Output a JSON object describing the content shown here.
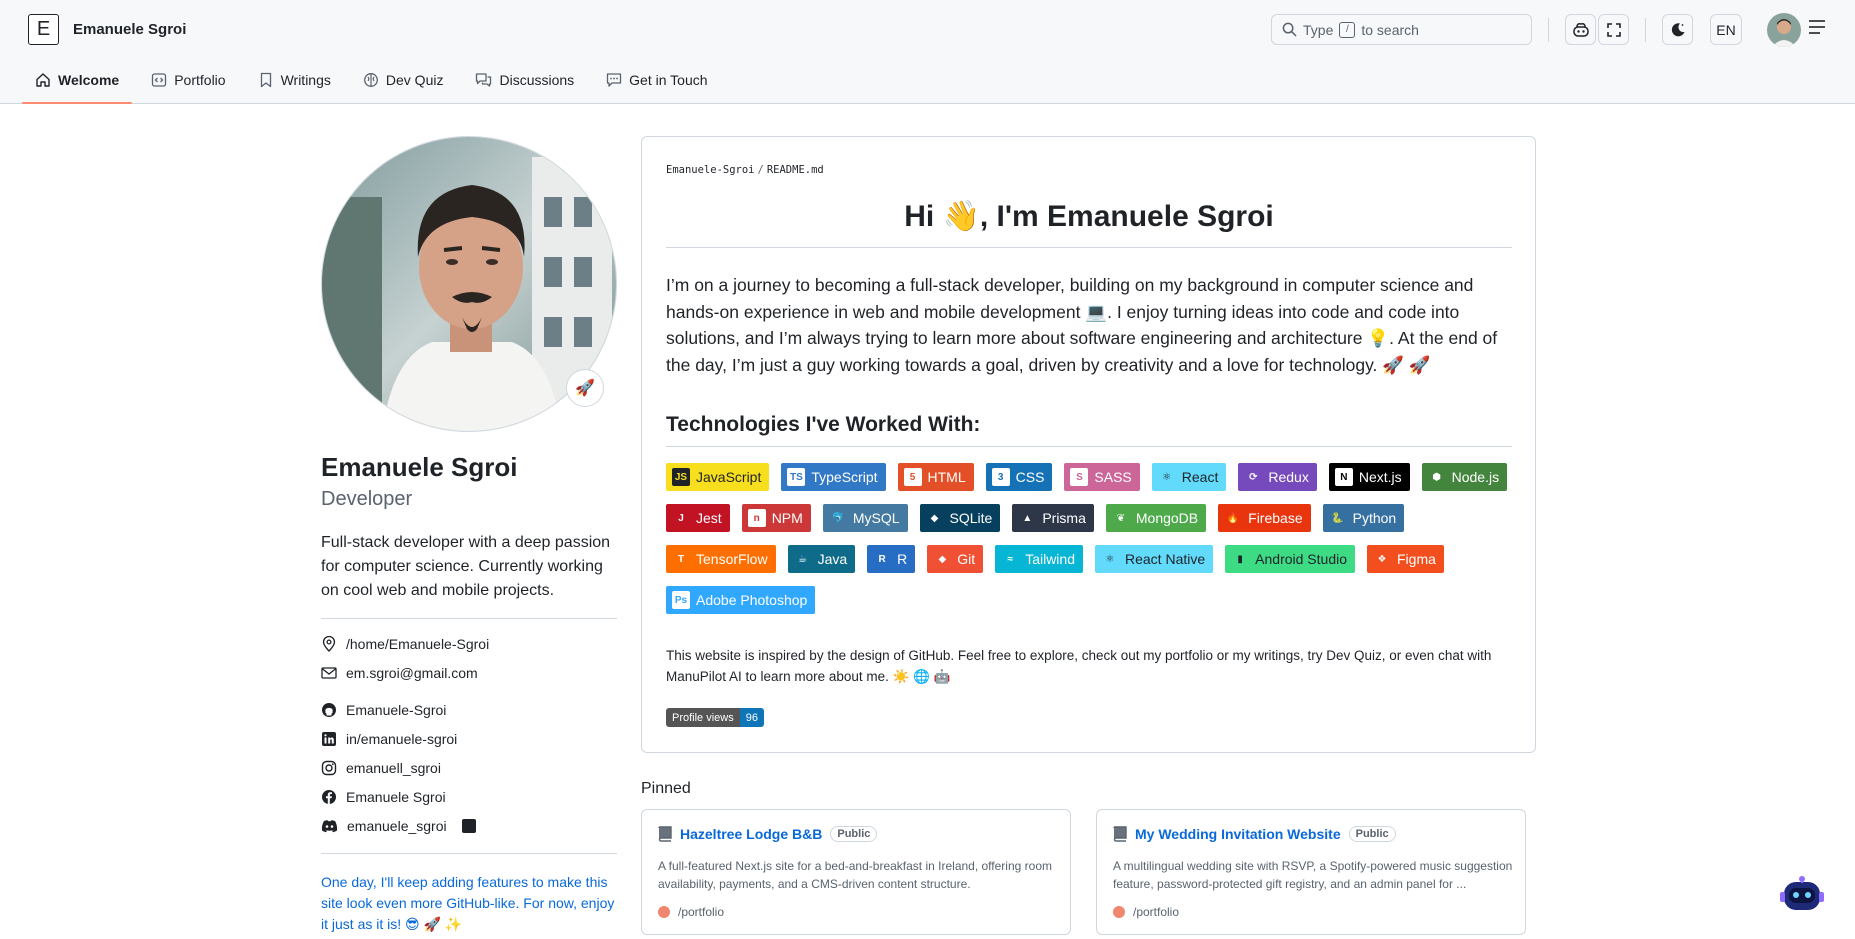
{
  "header": {
    "logo_letter": "E",
    "site_title": "Emanuele Sgroi",
    "search_prefix": "Type",
    "search_key": "/",
    "search_suffix": "to search",
    "lang": "EN"
  },
  "nav": [
    {
      "label": "Welcome",
      "icon": "home-icon",
      "active": true
    },
    {
      "label": "Portfolio",
      "icon": "code-square-icon"
    },
    {
      "label": "Writings",
      "icon": "bookmark-icon"
    },
    {
      "label": "Dev Quiz",
      "icon": "brain-icon"
    },
    {
      "label": "Discussions",
      "icon": "comments-icon"
    },
    {
      "label": "Get in Touch",
      "icon": "message-icon"
    }
  ],
  "profile": {
    "status_emoji": "🚀",
    "name": "Emanuele Sgroi",
    "role": "Developer",
    "bio": "Full-stack developer with a deep passion for computer science. Currently working on cool web and mobile projects.",
    "location": "/home/Emanuele-Sgroi",
    "email": "em.sgroi@gmail.com",
    "github": "Emanuele-Sgroi",
    "linkedin": "in/emanuele-sgroi",
    "instagram": "emanuell_sgroi",
    "facebook": "Emanuele Sgroi",
    "discord": "emanuele_sgroi",
    "note": "One day, I'll keep adding features to make this site look even more GitHub-like. For now, enjoy it just as it is! 😎 🚀 ✨"
  },
  "readme": {
    "path_user": "Emanuele-Sgroi",
    "path_file": "README.md",
    "title": "Hi 👋, I'm Emanuele Sgroi",
    "intro": "I’m on a journey to becoming a full-stack developer, building on my background in computer science and hands-on experience in web and mobile development 💻. I enjoy turning ideas into code and code into solutions, and I’m always trying to learn more about software engineering and architecture 💡. At the end of the day, I’m just a guy working towards a goal, driven by creativity and a love for technology. 🚀 🚀",
    "tech_heading": "Technologies I've Worked With:",
    "badges": [
      {
        "label": "JavaScript",
        "bg": "#f7df1e",
        "fg": "#1f2328",
        "icon": "JS",
        "ibg": "#1f2328",
        "ifg": "#f7df1e"
      },
      {
        "label": "TypeScript",
        "bg": "#3178c6",
        "fg": "#ffffff",
        "icon": "TS",
        "ibg": "#ffffff",
        "ifg": "#3178c6"
      },
      {
        "label": "HTML",
        "bg": "#e34f26",
        "fg": "#ffffff",
        "icon": "5",
        "ibg": "#ffffff",
        "ifg": "#e34f26"
      },
      {
        "label": "CSS",
        "bg": "#1572b6",
        "fg": "#ffffff",
        "icon": "3",
        "ibg": "#ffffff",
        "ifg": "#1572b6"
      },
      {
        "label": "SASS",
        "bg": "#cc6699",
        "fg": "#ffffff",
        "icon": "S",
        "ibg": "#ffffff",
        "ifg": "#cc6699"
      },
      {
        "label": "React",
        "bg": "#61dafb",
        "fg": "#1f2328",
        "icon": "⚛",
        "ibg": "transparent",
        "ifg": "#20232a"
      },
      {
        "label": "Redux",
        "bg": "#764abc",
        "fg": "#ffffff",
        "icon": "⟳",
        "ibg": "transparent",
        "ifg": "#ffffff"
      },
      {
        "label": "Next.js",
        "bg": "#000000",
        "fg": "#ffffff",
        "icon": "N",
        "ibg": "#ffffff",
        "ifg": "#000000"
      },
      {
        "label": "Node.js",
        "bg": "#43853d",
        "fg": "#ffffff",
        "icon": "⬢",
        "ibg": "transparent",
        "ifg": "#ffffff"
      },
      {
        "label": "Jest",
        "bg": "#c21325",
        "fg": "#ffffff",
        "icon": "J",
        "ibg": "transparent",
        "ifg": "#ffffff"
      },
      {
        "label": "NPM",
        "bg": "#cb3837",
        "fg": "#ffffff",
        "icon": "n",
        "ibg": "#ffffff",
        "ifg": "#cb3837"
      },
      {
        "label": "MySQL",
        "bg": "#4479a1",
        "fg": "#ffffff",
        "icon": "🐬",
        "ibg": "transparent",
        "ifg": "#ffffff"
      },
      {
        "label": "SQLite",
        "bg": "#07405e",
        "fg": "#ffffff",
        "icon": "◆",
        "ibg": "transparent",
        "ifg": "#ffffff"
      },
      {
        "label": "Prisma",
        "bg": "#3982ce",
        "fg": "#ffffff",
        "icon": "▲",
        "ibg": "transparent",
        "ifg": "#ffffff",
        "alt_bg": "#2d3748"
      },
      {
        "label": "MongoDB",
        "bg": "#4ea94b",
        "fg": "#ffffff",
        "icon": "❦",
        "ibg": "transparent",
        "ifg": "#ffffff"
      },
      {
        "label": "Firebase",
        "bg": "#e8350e",
        "fg": "#ffffff",
        "icon": "🔥",
        "ibg": "transparent",
        "ifg": "#ffca28"
      },
      {
        "label": "Python",
        "bg": "#3670a0",
        "fg": "#ffffff",
        "icon": "🐍",
        "ibg": "transparent",
        "ifg": "#ffdd54"
      },
      {
        "label": "TensorFlow",
        "bg": "#ff6f00",
        "fg": "#ffffff",
        "icon": "T",
        "ibg": "transparent",
        "ifg": "#ffffff"
      },
      {
        "label": "Java",
        "bg": "#0f6b8a",
        "fg": "#ffffff",
        "icon": "☕",
        "ibg": "transparent",
        "ifg": "#ffffff"
      },
      {
        "label": "R",
        "bg": "#276dc3",
        "fg": "#ffffff",
        "icon": "R",
        "ibg": "transparent",
        "ifg": "#ffffff"
      },
      {
        "label": "Git",
        "bg": "#f05033",
        "fg": "#ffffff",
        "icon": "◆",
        "ibg": "transparent",
        "ifg": "#ffffff"
      },
      {
        "label": "Tailwind",
        "bg": "#06b6d4",
        "fg": "#ffffff",
        "icon": "≈",
        "ibg": "transparent",
        "ifg": "#ffffff"
      },
      {
        "label": "React Native",
        "bg": "#61dafb",
        "fg": "#1f2328",
        "icon": "⚛",
        "ibg": "transparent",
        "ifg": "#20232a"
      },
      {
        "label": "Android Studio",
        "bg": "#3ddc84",
        "fg": "#1f2328",
        "icon": "▮",
        "ibg": "transparent",
        "ifg": "#1f2328"
      },
      {
        "label": "Figma",
        "bg": "#f24e1e",
        "fg": "#ffffff",
        "icon": "❖",
        "ibg": "transparent",
        "ifg": "#ffffff"
      },
      {
        "label": "Adobe Photoshop",
        "bg": "#31a8ff",
        "fg": "#ffffff",
        "icon": "Ps",
        "ibg": "#ffffff",
        "ifg": "#31a8ff"
      }
    ],
    "footer": "This website is inspired by the design of GitHub. Feel free to explore, check out my portfolio or my writings, try Dev Quiz, or even chat with ManuPilot AI to learn more about me. ☀️ 🌐 🤖",
    "views_label": "Profile views",
    "views_count": "96"
  },
  "pinned": {
    "heading": "Pinned",
    "cards": [
      {
        "title": "Hazeltree Lodge B&B",
        "visibility": "Public",
        "desc": "A full-featured Next.js site for a bed-and-breakfast in Ireland, offering room availability, payments, and a CMS-driven content structure.",
        "lang": "/portfolio"
      },
      {
        "title": "My Wedding Invitation Website",
        "visibility": "Public",
        "desc": "A multilingual wedding site with RSVP, a Spotify-powered music suggestion feature, password-protected gift registry, and an admin panel for ...",
        "lang": "/portfolio"
      }
    ]
  },
  "colors": {
    "accent": "#fd8c73",
    "link": "#0969da",
    "lang_dot": "#f1866f"
  }
}
